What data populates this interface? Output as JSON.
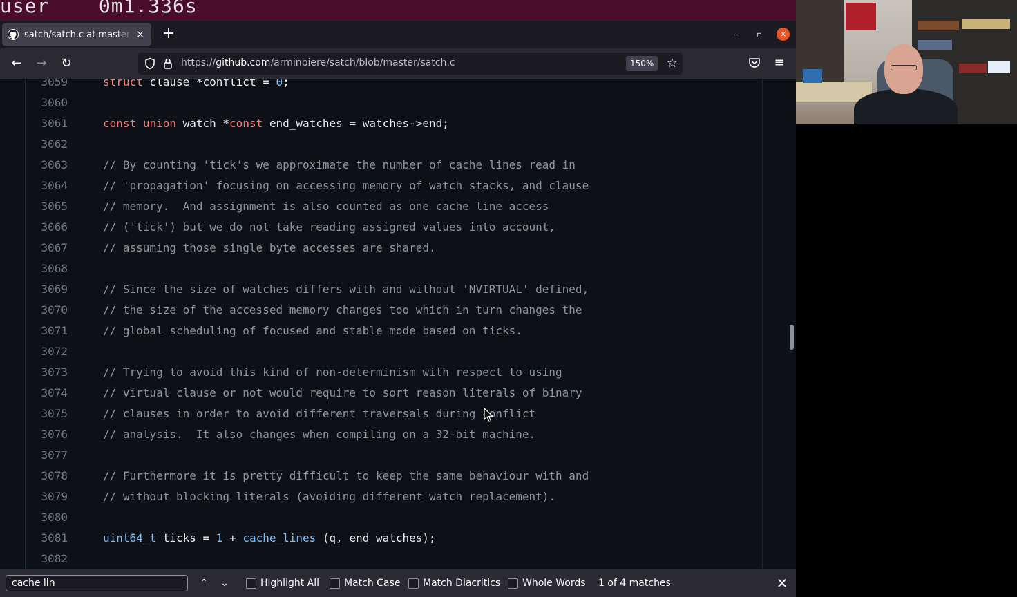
{
  "terminal": {
    "text": "user    0m1.336s"
  },
  "tab": {
    "title": "satch/satch.c at master · arminbiere/satch",
    "close": "×"
  },
  "new_tab": "+",
  "window": {
    "minimize": "–",
    "restore": "▫",
    "close": "×"
  },
  "nav": {
    "back": "←",
    "forward": "→",
    "reload": "↻"
  },
  "urlbar": {
    "prefix": "https://",
    "host": "github.com",
    "path": "/arminbiere/satch/blob/master/satch.c",
    "zoom": "150%",
    "star": "☆"
  },
  "menu": "≡",
  "code": {
    "lines": [
      {
        "num": "3059",
        "segments": [
          [
            "kw",
            "struct"
          ],
          [
            "",
            " clause *conflict = "
          ],
          [
            "num",
            "0"
          ],
          [
            "",
            ";"
          ]
        ]
      },
      {
        "num": "3060",
        "segments": []
      },
      {
        "num": "3061",
        "segments": [
          [
            "kw",
            "const"
          ],
          [
            "",
            " "
          ],
          [
            "kw",
            "union"
          ],
          [
            "",
            " watch *"
          ],
          [
            "kw",
            "const"
          ],
          [
            "",
            " end_watches = watches->end;"
          ]
        ]
      },
      {
        "num": "3062",
        "segments": []
      },
      {
        "num": "3063",
        "segments": [
          [
            "cm",
            "// By counting 'tick's we approximate the number of cache lines read in"
          ]
        ]
      },
      {
        "num": "3064",
        "segments": [
          [
            "cm",
            "// 'propagation' focusing on accessing memory of watch stacks, and clause"
          ]
        ]
      },
      {
        "num": "3065",
        "segments": [
          [
            "cm",
            "// memory.  And assignment is also counted as one cache line access"
          ]
        ]
      },
      {
        "num": "3066",
        "segments": [
          [
            "cm",
            "// ('tick') but we do not take reading assigned values into account,"
          ]
        ]
      },
      {
        "num": "3067",
        "segments": [
          [
            "cm",
            "// assuming those single byte accesses are shared."
          ]
        ]
      },
      {
        "num": "3068",
        "segments": []
      },
      {
        "num": "3069",
        "segments": [
          [
            "cm",
            "// Since the size of watches differs with and without 'NVIRTUAL' defined,"
          ]
        ]
      },
      {
        "num": "3070",
        "segments": [
          [
            "cm",
            "// the size of the accessed memory changes too which in turn changes the"
          ]
        ]
      },
      {
        "num": "3071",
        "segments": [
          [
            "cm",
            "// global scheduling of focused and stable mode based on ticks."
          ]
        ]
      },
      {
        "num": "3072",
        "segments": []
      },
      {
        "num": "3073",
        "segments": [
          [
            "cm",
            "// Trying to avoid this kind of non-determinism with respect to using"
          ]
        ]
      },
      {
        "num": "3074",
        "segments": [
          [
            "cm",
            "// virtual clause or not would require to sort reason literals of binary"
          ]
        ]
      },
      {
        "num": "3075",
        "segments": [
          [
            "cm",
            "// clauses in order to avoid different traversals during conflict"
          ]
        ]
      },
      {
        "num": "3076",
        "segments": [
          [
            "cm",
            "// analysis.  It also changes when compiling on a 32-bit machine."
          ]
        ]
      },
      {
        "num": "3077",
        "segments": []
      },
      {
        "num": "3078",
        "segments": [
          [
            "cm",
            "// Furthermore it is pretty difficult to keep the same behaviour with and"
          ]
        ]
      },
      {
        "num": "3079",
        "segments": [
          [
            "cm",
            "// without blocking literals (avoiding different watch replacement)."
          ]
        ]
      },
      {
        "num": "3080",
        "segments": []
      },
      {
        "num": "3081",
        "segments": [
          [
            "ty",
            "uint64_t"
          ],
          [
            "",
            " ticks = "
          ],
          [
            "num",
            "1"
          ],
          [
            "",
            " + "
          ],
          [
            "ty",
            "cache_lines"
          ],
          [
            "",
            " (q, end_watches);"
          ]
        ]
      },
      {
        "num": "3082",
        "segments": []
      }
    ]
  },
  "findbar": {
    "query": "cache lin",
    "prev": "⌃",
    "next": "⌄",
    "highlight_all": "Highlight All",
    "match_case": "Match Case",
    "match_diacritics": "Match Diacritics",
    "whole_words": "Whole Words",
    "status": "1 of 4 matches",
    "close": "✕"
  }
}
